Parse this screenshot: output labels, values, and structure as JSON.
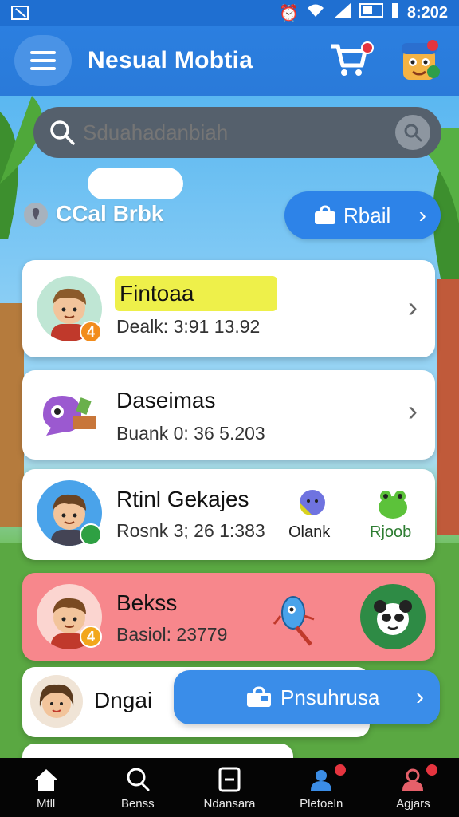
{
  "status_bar": {
    "time": "8:202"
  },
  "app_bar": {
    "title": "Nesual Mobtia"
  },
  "search": {
    "placeholder": "Sduahadanbiah"
  },
  "section": {
    "title": "CCal Brbk",
    "action_label": "Rbail"
  },
  "cards": [
    {
      "name": "Fintoaa",
      "sub": "Dealk: 3:91 13.92",
      "badge": "4",
      "badge_color": "#f28c1c"
    },
    {
      "name": "Daseimas",
      "sub": "Buank 0: 36 5.203"
    },
    {
      "name": "Rtinl Gekajes",
      "sub": "Rosnk 3; 26 1:383",
      "badge": "",
      "badge_color": "#2ea043",
      "extra_1": "Olank",
      "extra_2": "Rjoob"
    },
    {
      "name": "Bekss",
      "sub": "Basiol: 23779",
      "badge": "4",
      "badge_color": "#f2a71c"
    },
    {
      "name": "Dngai"
    }
  ],
  "fab": {
    "label": "Pnsuhrusa"
  },
  "bottom_nav": [
    {
      "label": "Mtll",
      "icon": "home-icon"
    },
    {
      "label": "Benss",
      "icon": "search-icon"
    },
    {
      "label": "Ndansara",
      "icon": "square-icon"
    },
    {
      "label": "Pletoeln",
      "icon": "people-icon"
    },
    {
      "label": "Agjars",
      "icon": "profile-icon"
    }
  ],
  "colors": {
    "primary": "#2b7fe0",
    "card_highlight": "#f78a8f",
    "nav_bg": "#050505"
  }
}
